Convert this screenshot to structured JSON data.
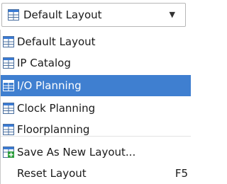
{
  "dropdown": {
    "selected": "Default Layout",
    "icon": "layout-icon",
    "arrow_icon": "chevron-down-icon"
  },
  "menu": {
    "layouts": [
      {
        "label": "Default Layout",
        "icon": "layout-icon",
        "selected": false
      },
      {
        "label": "IP Catalog",
        "icon": "layout-icon",
        "selected": false
      },
      {
        "label": "I/O Planning",
        "icon": "layout-icon",
        "selected": true
      },
      {
        "label": "Clock Planning",
        "icon": "layout-icon",
        "selected": false
      },
      {
        "label": "Floorplanning",
        "icon": "layout-icon",
        "selected": false
      }
    ],
    "actions": [
      {
        "label": "Save As New Layout...",
        "icon": "save-layout-icon",
        "shortcut": ""
      },
      {
        "label": "Reset Layout",
        "icon": "",
        "shortcut": "F5"
      }
    ]
  },
  "colors": {
    "selection": "#3f7fd0",
    "icon_accent": "#3a7bd5",
    "save_icon_accent": "#2e9e3e"
  }
}
